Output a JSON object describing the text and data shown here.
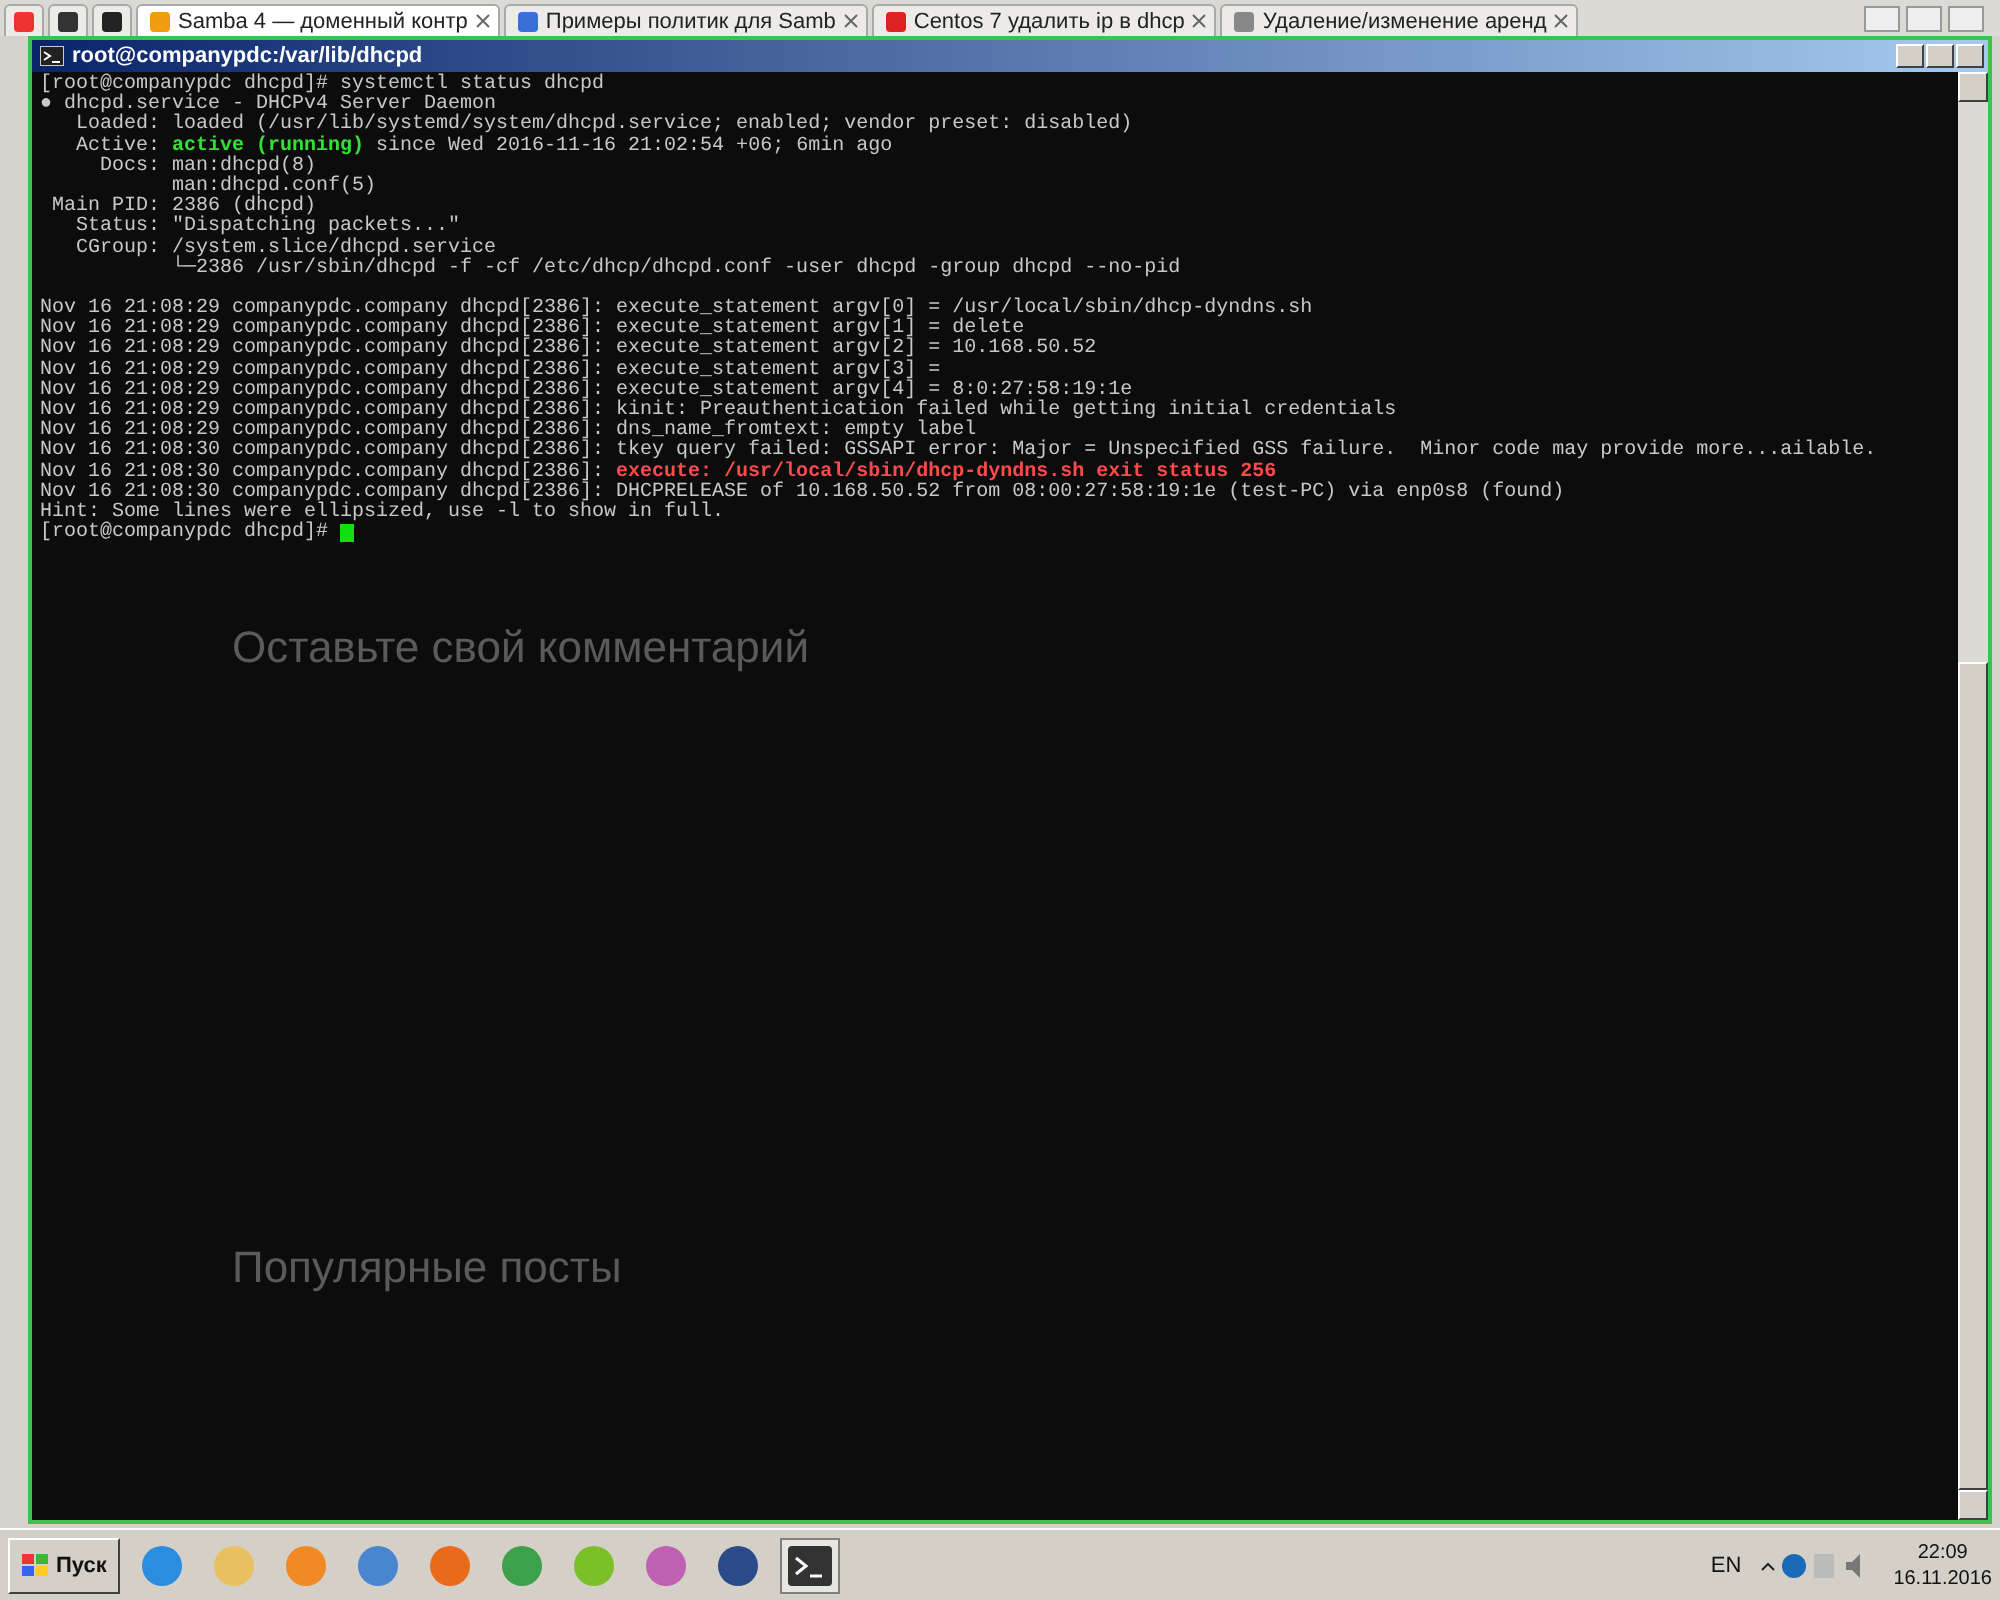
{
  "browser_tabs": [
    {
      "kind": "pinned",
      "selected": false
    },
    {
      "kind": "pinned",
      "selected": false
    },
    {
      "kind": "pinned",
      "selected": false
    },
    {
      "kind": "tab",
      "label": "Samba 4 — доменный контр",
      "selected": true
    },
    {
      "kind": "tab",
      "label": "Примеры политик для Samb",
      "selected": false
    },
    {
      "kind": "tab",
      "label": "Centos 7 удалить ip в dhcp",
      "selected": false
    },
    {
      "kind": "tab",
      "label": "Удаление/изменение аренд",
      "selected": false
    }
  ],
  "terminal": {
    "title": "root@companypdc:/var/lib/dhcpd",
    "lines": [
      [
        {
          "text": "[root@companypdc dhcpd]# systemctl status dhcpd",
          "kind": "normal"
        }
      ],
      [
        {
          "text": "● ",
          "kind": "bullet"
        },
        {
          "text": "dhcpd.service - DHCPv4 Server Daemon",
          "kind": "normal"
        }
      ],
      [
        {
          "text": "   Loaded: loaded (/usr/lib/systemd/system/dhcpd.service; enabled; vendor preset: disabled)",
          "kind": "normal"
        }
      ],
      [
        {
          "text": "   Active: ",
          "kind": "normal"
        },
        {
          "text": "active (running)",
          "kind": "ok"
        },
        {
          "text": " since Wed 2016-11-16 21:02:54 +06; 6min ago",
          "kind": "normal"
        }
      ],
      [
        {
          "text": "     Docs: man:dhcpd(8)",
          "kind": "normal"
        }
      ],
      [
        {
          "text": "           man:dhcpd.conf(5)",
          "kind": "normal"
        }
      ],
      [
        {
          "text": " Main PID: 2386 (dhcpd)",
          "kind": "normal"
        }
      ],
      [
        {
          "text": "   Status: \"Dispatching packets...\"",
          "kind": "normal"
        }
      ],
      [
        {
          "text": "   CGroup: /system.slice/dhcpd.service",
          "kind": "normal"
        }
      ],
      [
        {
          "text": "           └─2386 /usr/sbin/dhcpd -f -cf /etc/dhcp/dhcpd.conf -user dhcpd -group dhcpd --no-pid",
          "kind": "normal"
        }
      ],
      [
        {
          "kind": "blank"
        }
      ],
      [
        {
          "text": "Nov 16 21:08:29 companypdc.company dhcpd[2386]: execute_statement argv[0] = /usr/local/sbin/dhcp-dyndns.sh",
          "kind": "normal"
        }
      ],
      [
        {
          "text": "Nov 16 21:08:29 companypdc.company dhcpd[2386]: execute_statement argv[1] = delete",
          "kind": "normal"
        }
      ],
      [
        {
          "text": "Nov 16 21:08:29 companypdc.company dhcpd[2386]: execute_statement argv[2] = 10.168.50.52",
          "kind": "normal"
        }
      ],
      [
        {
          "text": "Nov 16 21:08:29 companypdc.company dhcpd[2386]: execute_statement argv[3] =",
          "kind": "normal"
        }
      ],
      [
        {
          "text": "Nov 16 21:08:29 companypdc.company dhcpd[2386]: execute_statement argv[4] = 8:0:27:58:19:1e",
          "kind": "normal"
        }
      ],
      [
        {
          "text": "Nov 16 21:08:29 companypdc.company dhcpd[2386]: kinit: Preauthentication failed while getting initial credentials",
          "kind": "normal"
        }
      ],
      [
        {
          "text": "Nov 16 21:08:29 companypdc.company dhcpd[2386]: dns_name_fromtext: empty label",
          "kind": "normal"
        }
      ],
      [
        {
          "text": "Nov 16 21:08:30 companypdc.company dhcpd[2386]: tkey query failed: GSSAPI error: Major = Unspecified GSS failure.  Minor code may provide more...ailable.",
          "kind": "normal"
        }
      ],
      [
        {
          "text": "Nov 16 21:08:30 companypdc.company dhcpd[2386]: ",
          "kind": "normal"
        },
        {
          "text": "execute: /usr/local/sbin/dhcp-dyndns.sh exit status 256",
          "kind": "error"
        }
      ],
      [
        {
          "text": "Nov 16 21:08:30 companypdc.company dhcpd[2386]: DHCPRELEASE of 10.168.50.52 from 08:00:27:58:19:1e (test-PC) via enp0s8 (found)",
          "kind": "normal"
        }
      ],
      [
        {
          "text": "Hint: Some lines were ellipsized, use -l to show in full.",
          "kind": "normal"
        }
      ],
      [
        {
          "text": "[root@companypdc dhcpd]# ",
          "kind": "normal"
        },
        {
          "kind": "cursor"
        }
      ]
    ]
  },
  "background_page": {
    "comment_heading": "Оставьте свой комментарий",
    "popular_heading": "Популярные посты"
  },
  "taskbar": {
    "start_label": "Пуск",
    "language": "EN",
    "time": "22:09",
    "date": "16.11.2016"
  }
}
